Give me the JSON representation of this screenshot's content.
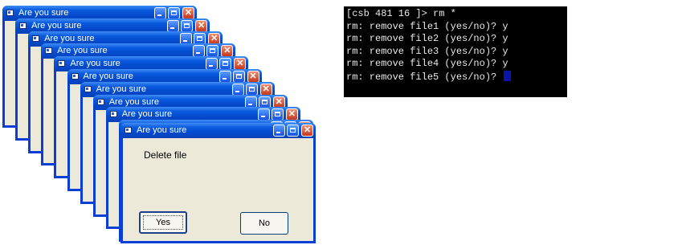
{
  "dialogs": [
    {
      "title": "Are you sure"
    },
    {
      "title": "Are you sure"
    },
    {
      "title": "Are you sure"
    },
    {
      "title": "Are you sure"
    },
    {
      "title": "Are you sure"
    },
    {
      "title": "Are you sure"
    },
    {
      "title": "Are you sure"
    },
    {
      "title": "Are you sure"
    },
    {
      "title": "Are you sure"
    },
    {
      "title": "Are you sure"
    }
  ],
  "front_dialog": {
    "title": "Are you sure",
    "message": "Delete file",
    "yes_label": "Yes",
    "no_label": "No"
  },
  "terminal": {
    "lines": [
      "[csb 481 16 ]> rm *",
      "rm: remove file1 (yes/no)? y",
      "rm: remove file2 (yes/no)? y",
      "rm: remove file3 (yes/no)? y",
      "rm: remove file4 (yes/no)? y",
      "rm: remove file5 (yes/no)? "
    ]
  },
  "colors": {
    "titlebar": "#0a5adf",
    "dialog_face": "#ece9d8",
    "terminal_bg": "#000000",
    "terminal_text": "#e8e8e8",
    "cursor": "#0b14a8"
  }
}
